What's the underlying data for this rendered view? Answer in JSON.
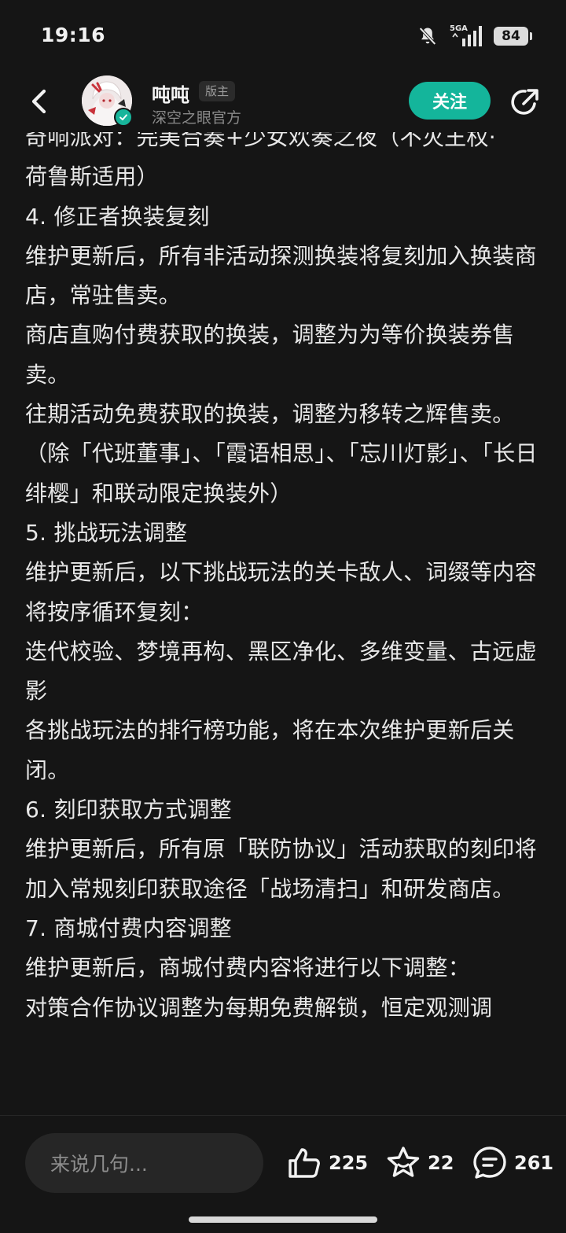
{
  "status_bar": {
    "time": "19:16",
    "network": "5GA",
    "battery": "84"
  },
  "header": {
    "author_name": "吨吨",
    "role_badge": "版主",
    "author_subtitle": "深空之眼官方",
    "follow_label": "关注"
  },
  "content": {
    "paragraphs": [
      "奇响派对：完美合奏+少女欢奏之夜（不灭王权·",
      "荷鲁斯适用）",
      "4. 修正者换装复刻",
      "维护更新后，所有非活动探测换装将复刻加入换装商店，常驻售卖。",
      "商店直购付费获取的换装，调整为为等价换装券售卖。",
      "往期活动免费获取的换装，调整为移转之辉售卖。",
      "（除「代班董事」、「霞语相思」、「忘川灯影」、「长日绯樱」和联动限定换装外）",
      "5. 挑战玩法调整",
      "维护更新后，以下挑战玩法的关卡敌人、词缀等内容将按序循环复刻：",
      "迭代校验、梦境再构、黑区净化、多维变量、古远虚影",
      "各挑战玩法的排行榜功能，将在本次维护更新后关闭。",
      "6. 刻印获取方式调整",
      "维护更新后，所有原「联防协议」活动获取的刻印将加入常规刻印获取途径「战场清扫」和研发商店。",
      "7. 商城付费内容调整",
      "维护更新后，商城付费内容将进行以下调整：",
      "对策合作协议调整为每期免费解锁，恒定观测调"
    ]
  },
  "bottom_bar": {
    "comment_placeholder": "来说几句...",
    "like_count": "225",
    "favorite_count": "22",
    "comment_count": "261"
  },
  "colors": {
    "background": "#151515",
    "accent": "#14b59b",
    "text": "#e8e8e8",
    "muted": "#8a8a8a"
  }
}
